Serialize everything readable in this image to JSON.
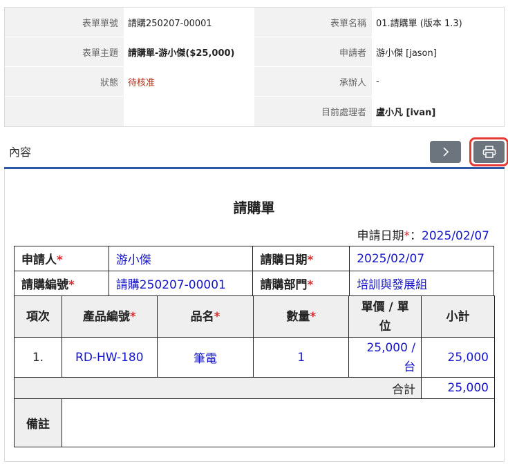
{
  "info": {
    "form_no_label": "表單單號",
    "form_no": "請購250207-00001",
    "form_name_label": "表單名稱",
    "form_name": "01.請購單 (版本 1.3)",
    "subject_label": "表單主題",
    "subject": "請購單-游小傑($25,000)",
    "applicant_label": "申請者",
    "applicant": "游小傑 [jason]",
    "status_label": "狀態",
    "status": "待核准",
    "handler_label": "承辦人",
    "handler": "-",
    "current_label": "目前處理者",
    "current": "盧小凡 [ivan]"
  },
  "toolbar": {
    "section_title": "內容",
    "next_icon": "chevron-right-icon",
    "print_icon": "printer-icon"
  },
  "form": {
    "title": "請購單",
    "apply_date_label": "申請日期",
    "apply_date_sep": "：",
    "apply_date": "2025/02/07",
    "required_mark": "*",
    "applicant_label": "申請人",
    "applicant": "游小傑",
    "purchase_date_label": "請購日期",
    "purchase_date": "2025/02/07",
    "purchase_no_label": "請購編號",
    "purchase_no": "請購250207-00001",
    "dept_label": "請購部門",
    "dept": "培訓與發展組",
    "columns": {
      "item": "項次",
      "product_no": "產品編號",
      "product_name": "品名",
      "qty": "數量",
      "unit_price_line1": "單價 / 單",
      "unit_price_line2": "位",
      "subtotal": "小計"
    },
    "rows": [
      {
        "item": "1.",
        "product_no": "RD-HW-180",
        "product_name": "筆電",
        "qty": "1",
        "unit_price": "25,000 /",
        "unit": "台",
        "subtotal": "25,000"
      }
    ],
    "total_label": "合計",
    "total": "25,000",
    "note_label": "備註",
    "note": ""
  },
  "colors": {
    "accent_line": "#2a57a6",
    "value_blue": "#1414c8",
    "required_red": "#d32f2f",
    "status_red": "#b22d16",
    "button_gray": "#6c757d",
    "highlight_red": "#e53935"
  }
}
